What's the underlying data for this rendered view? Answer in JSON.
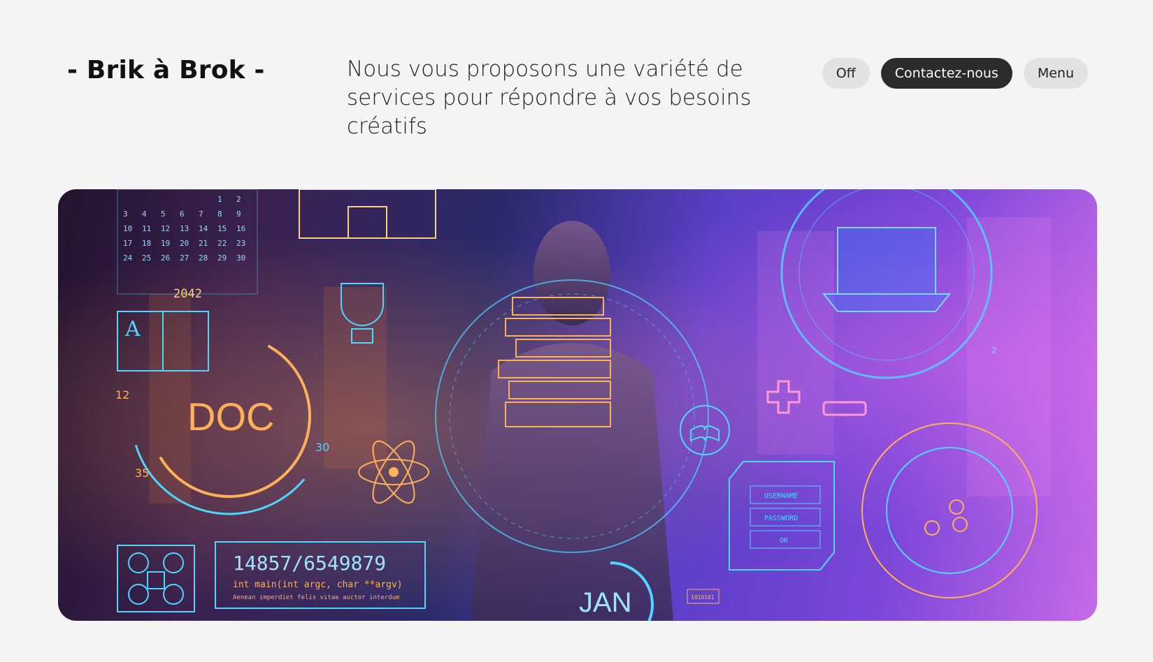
{
  "brand": {
    "name": "- Brik à Brok -"
  },
  "tagline": {
    "text": "Nous vous proposons une variété de services pour répondre à vos besoins créatifs"
  },
  "nav": {
    "off_label": "Off",
    "contact_label": "Contactez-nous",
    "menu_label": "Menu"
  },
  "hero": {
    "calendar_rows": [
      [
        "",
        "",
        "",
        "",
        "",
        "1",
        "2"
      ],
      [
        "3",
        "4",
        "5",
        "6",
        "7",
        "8",
        "9"
      ],
      [
        "10",
        "11",
        "12",
        "13",
        "14",
        "15",
        "16"
      ],
      [
        "17",
        "18",
        "19",
        "20",
        "21",
        "22",
        "23"
      ],
      [
        "24",
        "25",
        "26",
        "27",
        "28",
        "29",
        "30"
      ]
    ],
    "year": "2042",
    "doc_label": "DOC",
    "gauge_labels": {
      "left": "12",
      "bottom": "35",
      "right": "30"
    },
    "counter": "14857/6549879",
    "code_line": "int main(int argc, char **argv)",
    "code_sub": "Aenean imperdiet felis vitae auctor interdum",
    "month": "JAN",
    "login_username": "USERNAME",
    "login_password": "PASSWORD",
    "login_ok": "OK",
    "binary": "1010101",
    "small_2": "2",
    "colors": {
      "cyan": "#4fd6ff",
      "orange": "#ffb15a",
      "violet": "#8b5cf6"
    }
  }
}
